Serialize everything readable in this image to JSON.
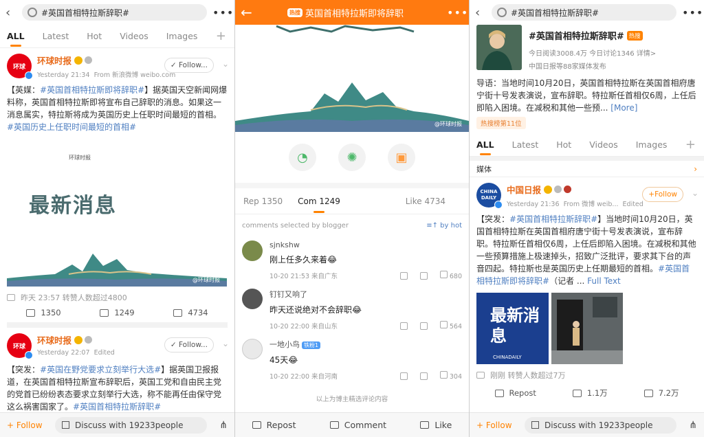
{
  "panel1": {
    "search_text": "#英国首相特拉斯辞职#",
    "tabs": [
      "ALL",
      "Latest",
      "Hot",
      "Videos",
      "Images"
    ],
    "post1": {
      "author": "环球时报",
      "time": "Yesterday 21:34",
      "source": "From 新浪微博 weibo.com",
      "follow": "Follow...",
      "text_prefix": "【英媒：",
      "tag1": "#英国首相特拉斯即将辞职#",
      "text_mid": "】据英国天空新闻网爆料称，英国首相特拉斯即将宣布自己辞职的消息。如果这一消息属实，特拉斯将成为英国历史上任职时间最短的首相。",
      "tag2": "#英国历史上任职时间最短的首相#",
      "img_small": "环球时报",
      "img_big": "最新消息",
      "img_wm": "@环球时报",
      "liked": "昨天 23:57 转赞人数超过4800",
      "reposts": "1350",
      "comments": "1249",
      "likes": "4734"
    },
    "post2": {
      "author": "环球时报",
      "time": "Yesterday 22:07",
      "edited": "Edited",
      "follow": "Follow...",
      "text_prefix": "【突发：",
      "tag1": "#英国在野党要求立刻举行大选#",
      "text_mid": "】据英国卫报报道，在英国首相特拉斯宣布辞职后，英国工党和自由民主党的党首已纷纷表态要求立刻举行大选，称不能再任由保守党这么祸害国家了。",
      "tag2": "#英国首相特拉斯辞职#"
    },
    "bottom": {
      "follow": "+ Follow",
      "discuss": "Discuss with 19233people"
    }
  },
  "panel2": {
    "badge": "热搜",
    "title": "英国首相特拉斯即将辞职",
    "banner_wm": "@环球时报",
    "tabs": {
      "rep": "Rep 1350",
      "com": "Com 1249",
      "like": "Like 4734"
    },
    "selected_by": "comments selected by blogger",
    "by_hot": "by hot",
    "comments": [
      {
        "user": "sjnkshw",
        "vip": "",
        "text": "刚上任多久来着😂",
        "time": "10-20 21:53 来自广东",
        "likes": "680"
      },
      {
        "user": "钉钉又响了",
        "vip": "",
        "text": "昨天还说绝对不会辞职😂",
        "time": "10-20 22:00 来自山东",
        "likes": "564"
      },
      {
        "user": "一地小鸟",
        "vip": "铁粉1",
        "text": "45天😂",
        "time": "10-20 22:00 来自河南",
        "likes": "304"
      }
    ],
    "end_text": "以上为博主精选评论内容",
    "bottom": {
      "repost": "Repost",
      "comment": "Comment",
      "like": "Like"
    }
  },
  "panel3": {
    "search_text": "#英国首相特拉斯辞职#",
    "topic_title": "#英国首相特拉斯辞职#",
    "hot_badge": "热搜",
    "stats": "今日阅读3008.4万  今日讨论1346  详情>",
    "source": "中国日报等88家媒体发布",
    "lead_label": "导语：",
    "lead": "当地时间10月20日，英国首相特拉斯在英国首相府唐宁街十号发表演说，宣布辞职。特拉斯任首相仅6周，上任后即陷入困境。在减税和其他一些预...",
    "more": "[More]",
    "rank": "热搜榜第11位",
    "tabs": [
      "ALL",
      "Latest",
      "Hot",
      "Videos",
      "Images"
    ],
    "section": "媒体",
    "post": {
      "author": "中国日报",
      "time": "Yesterday 21:36",
      "source": "From 微博 weib...",
      "edited": "Edited",
      "follow": "+Follow",
      "avatar": "CHINA DAILY",
      "text_prefix": "【突发：",
      "tag1": "#英国首相特拉斯辞职#",
      "text_mid": "】当地时间10月20日，英国首相特拉斯在英国首相府唐宁街十号发表演说，宣布辞职。特拉斯任首相仅6周，上任后即陷入困境。在减税和其他一些预算措施上极速掉头，招致广泛批评，要求其下台的声音四起。特拉斯也是英国历史上任期最短的首相。",
      "tag2": "#英国首相特拉斯即将辞职#",
      "text_end": "（记者 ...",
      "full": "Full Text",
      "img_big": "最新消息",
      "img_brand": "CHINADAILY",
      "liked": "刚刚 转赞人数超过7万",
      "repost": "Repost",
      "comments": "1.1万",
      "likes": "7.2万"
    },
    "bottom": {
      "follow": "+ Follow",
      "discuss": "Discuss with 19233people"
    }
  }
}
